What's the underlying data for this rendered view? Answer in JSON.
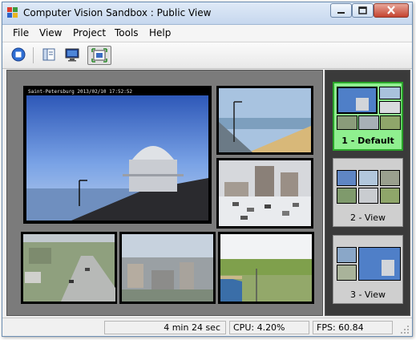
{
  "window": {
    "title": "Computer Vision Sandbox : Public View",
    "accent": "#c6d7ee"
  },
  "menu": {
    "items": [
      "File",
      "View",
      "Project",
      "Tools",
      "Help"
    ]
  },
  "toolbar": {
    "buttons": [
      {
        "icon": "stop-icon"
      },
      {
        "icon": "panel-icon"
      },
      {
        "icon": "monitor-icon"
      },
      {
        "icon": "fullscreen-icon",
        "active": true
      }
    ]
  },
  "cameras": [
    {
      "name": "observatory-dome",
      "overlay": "Saint-Petersburg 2013/02/10 17:52:52"
    },
    {
      "name": "beach-lamppost"
    },
    {
      "name": "snowy-parking"
    },
    {
      "name": "city-road"
    },
    {
      "name": "city-rooftops"
    },
    {
      "name": "field-pole"
    }
  ],
  "views": [
    {
      "label": "1 - Default",
      "selected": true,
      "color": "#8ff08f"
    },
    {
      "label": "2 - View",
      "selected": false
    },
    {
      "label": "3 - View",
      "selected": false
    }
  ],
  "status": {
    "uptime": "4 min 24 sec",
    "cpu": "CPU: 4.20%",
    "fps": "FPS: 60.84"
  }
}
